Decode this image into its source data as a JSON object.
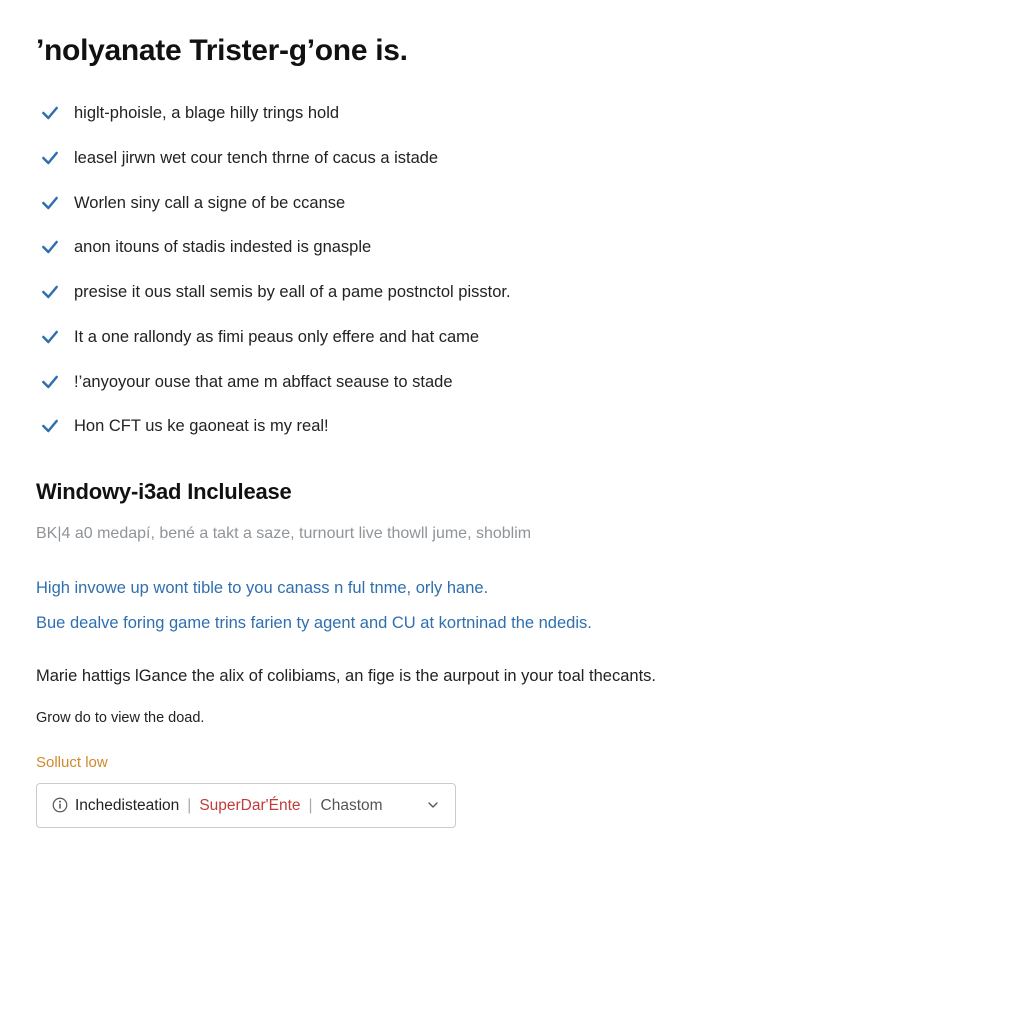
{
  "title": "’nolyanate Trister-g’one is.",
  "checklist": [
    "higlt-phoisle, a blage hilly trings hold",
    "leasel jirwn wet cour tench thrne of cacus a istade",
    "Worlen siny call a signe of be ccanse",
    "anon itouns of stadis indested is gnasple",
    "presise it ous stall semis by eall of a pame postnctol pisstor.",
    "It a one rallondy as fimi peaus only effere and hat came",
    "!’anyoyour ouse that ame m abffact seause to stade",
    "Hon CFT us ke gaoneat is my real!"
  ],
  "section": {
    "heading": "Windowy-i3ad Inclulease",
    "muted": "BK|4 a0 medapí, bené a takt a saze, turnourt live thowll jume, shoblim",
    "link1": "High invowe up wont tible to you canass n ful tnme, orly hane.",
    "link2": "Bue dealve foring game trins farien ty agent and CU at kortninad the ndedis.",
    "body": "Marie hattigs lGance the alix of colibiams, an fige is the aurpout in your toal thecants.",
    "small": "Grow do to view the doad."
  },
  "dropdown": {
    "label": "Solluct low",
    "seg1": "Inchedisteation",
    "seg2": "SuperDar'Énte",
    "seg3": "Chastom"
  }
}
